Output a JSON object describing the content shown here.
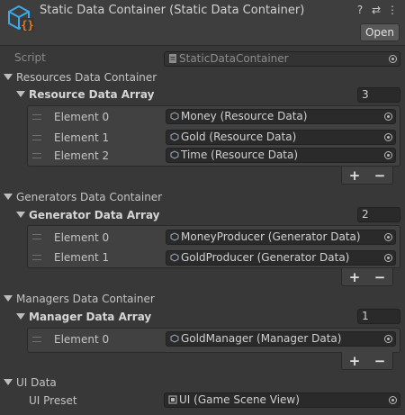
{
  "header": {
    "title": "Static Data Container (Static Data Container)",
    "help_icon": "help-icon",
    "settings_icon": "presets-icon",
    "menu_icon": "more-options-icon",
    "open_label": "Open"
  },
  "script": {
    "label": "Script",
    "value": "StaticDataContainer"
  },
  "resources": {
    "label": "Resources Data Container",
    "array_label": "Resource Data Array",
    "size": "3",
    "elements": [
      {
        "label": "Element 0",
        "value": "Money (Resource Data)"
      },
      {
        "label": "Element 1",
        "value": "Gold (Resource Data)"
      },
      {
        "label": "Element 2",
        "value": "Time (Resource Data)"
      }
    ]
  },
  "generators": {
    "label": "Generators Data Container",
    "array_label": "Generator Data Array",
    "size": "2",
    "elements": [
      {
        "label": "Element 0",
        "value": "MoneyProducer (Generator Data)"
      },
      {
        "label": "Element 1",
        "value": "GoldProducer (Generator Data)"
      }
    ]
  },
  "managers": {
    "label": "Managers Data Container",
    "array_label": "Manager Data Array",
    "size": "1",
    "elements": [
      {
        "label": "Element 0",
        "value": "GoldManager (Manager Data)"
      }
    ]
  },
  "ui_data": {
    "label": "UI Data",
    "preset_label": "UI Preset",
    "preset_value": "UI (Game Scene View)"
  },
  "list_controls": {
    "add": "+",
    "remove": "−"
  },
  "colors": {
    "accent_icon": "#3fa8e6",
    "script_icon": "#e67c2a"
  }
}
